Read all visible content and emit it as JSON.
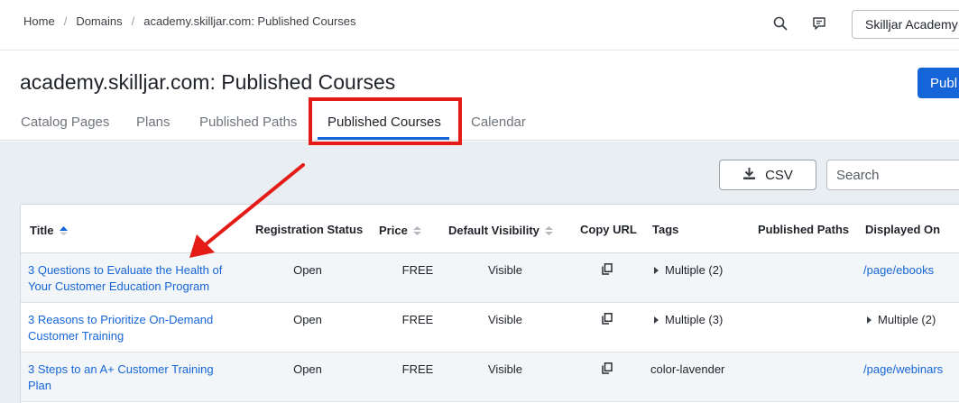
{
  "breadcrumb": {
    "items": [
      "Home",
      "Domains",
      "academy.skilljar.com: Published Courses"
    ],
    "separator": "/"
  },
  "topbar": {
    "account_label": "Skilljar Academy",
    "icons": [
      "search-icon",
      "chat-icon"
    ]
  },
  "header": {
    "title": "academy.skilljar.com: Published Courses",
    "publish_button": "Publ"
  },
  "tabs": [
    {
      "label": "Catalog Pages",
      "active": false
    },
    {
      "label": "Plans",
      "active": false
    },
    {
      "label": "Published Paths",
      "active": false
    },
    {
      "label": "Published Courses",
      "active": true
    },
    {
      "label": "Calendar",
      "active": false
    }
  ],
  "toolbar": {
    "csv_label": "CSV",
    "search_placeholder": "Search"
  },
  "table": {
    "columns": [
      "Title",
      "Registration Status",
      "Price",
      "Default Visibility",
      "Copy URL",
      "Tags",
      "Published Paths",
      "Displayed On"
    ],
    "rows": [
      {
        "title": "3 Questions to Evaluate the Health of Your Customer Education Program",
        "status": "Open",
        "price": "FREE",
        "visibility": "Visible",
        "tags": "Multiple (2)",
        "tags_expandable": true,
        "published_paths": "",
        "displayed_on": "/page/ebooks",
        "displayed_on_expandable": false
      },
      {
        "title": "3 Reasons to Prioritize On-Demand Customer Training",
        "status": "Open",
        "price": "FREE",
        "visibility": "Visible",
        "tags": "Multiple (3)",
        "tags_expandable": true,
        "published_paths": "",
        "displayed_on": "Multiple (2)",
        "displayed_on_expandable": true
      },
      {
        "title": "3 Steps to an A+ Customer Training Plan",
        "status": "Open",
        "price": "FREE",
        "visibility": "Visible",
        "tags": "color-lavender",
        "tags_expandable": false,
        "published_paths": "",
        "displayed_on": "/page/webinars",
        "displayed_on_expandable": false
      }
    ]
  },
  "colors": {
    "accent": "#1565d8",
    "annotation": "#e41b17",
    "content_bg": "#e9eef3"
  }
}
